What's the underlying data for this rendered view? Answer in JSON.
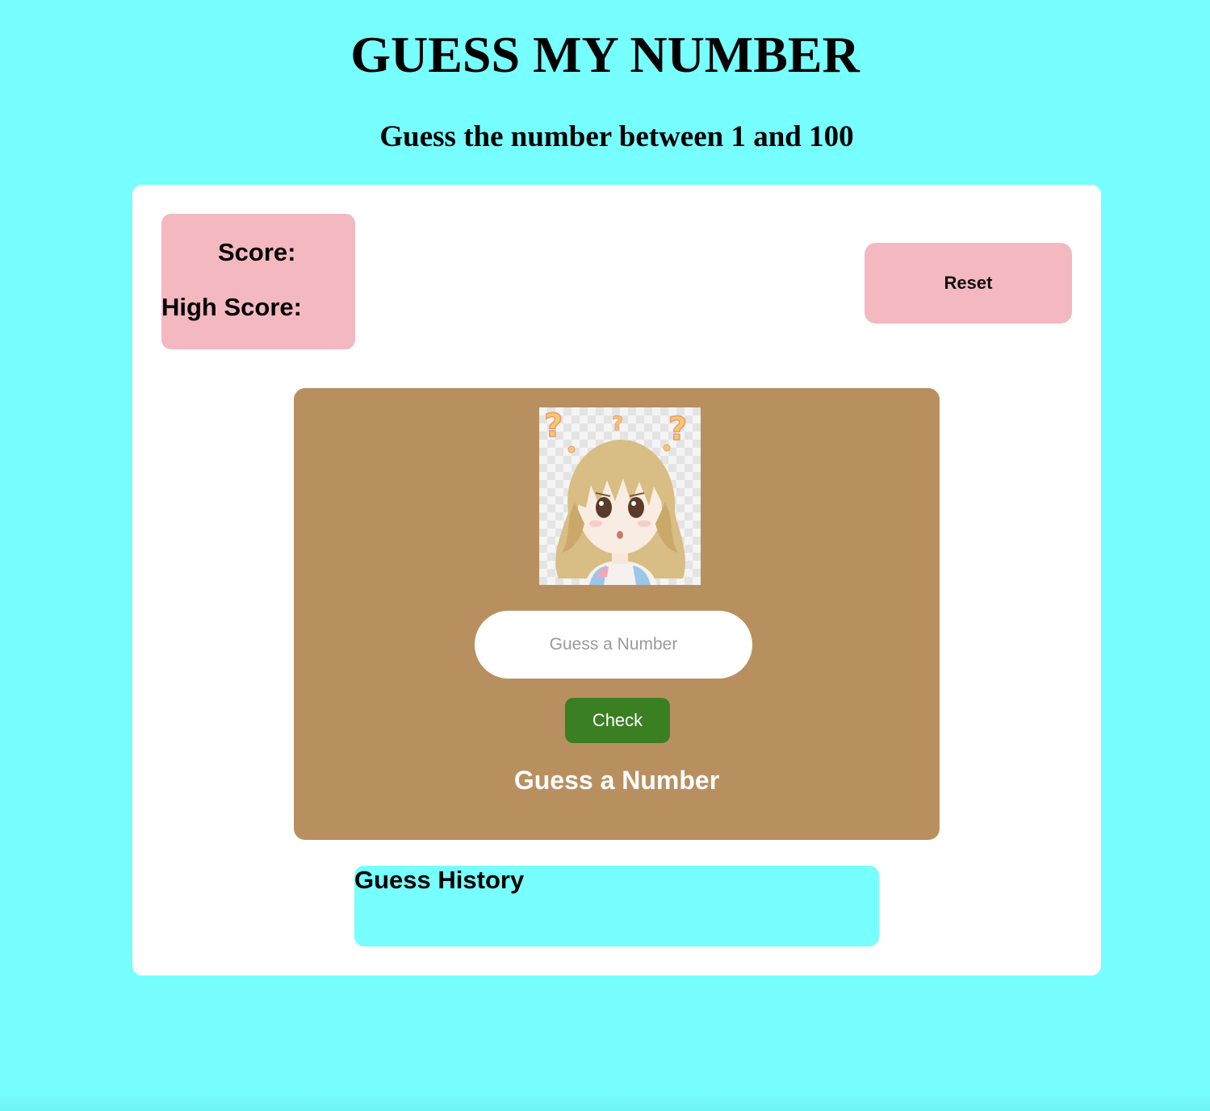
{
  "header": {
    "title": "GUESS MY NUMBER",
    "subtitle": "Guess the number between 1 and 100"
  },
  "scoreboard": {
    "score_label": "Score:",
    "high_score_label": "High Score:"
  },
  "controls": {
    "reset_label": "Reset",
    "guess_placeholder": "Guess a Number",
    "check_label": "Check"
  },
  "game": {
    "message": "Guess a Number",
    "character_icon": "confused-girl-icon"
  },
  "history": {
    "title": "Guess History"
  },
  "colors": {
    "page_background": "#77fefe",
    "card_background": "#ffffff",
    "pink_accent": "#f4b8c1",
    "game_panel": "#b89060",
    "check_button": "#3a7f22"
  }
}
